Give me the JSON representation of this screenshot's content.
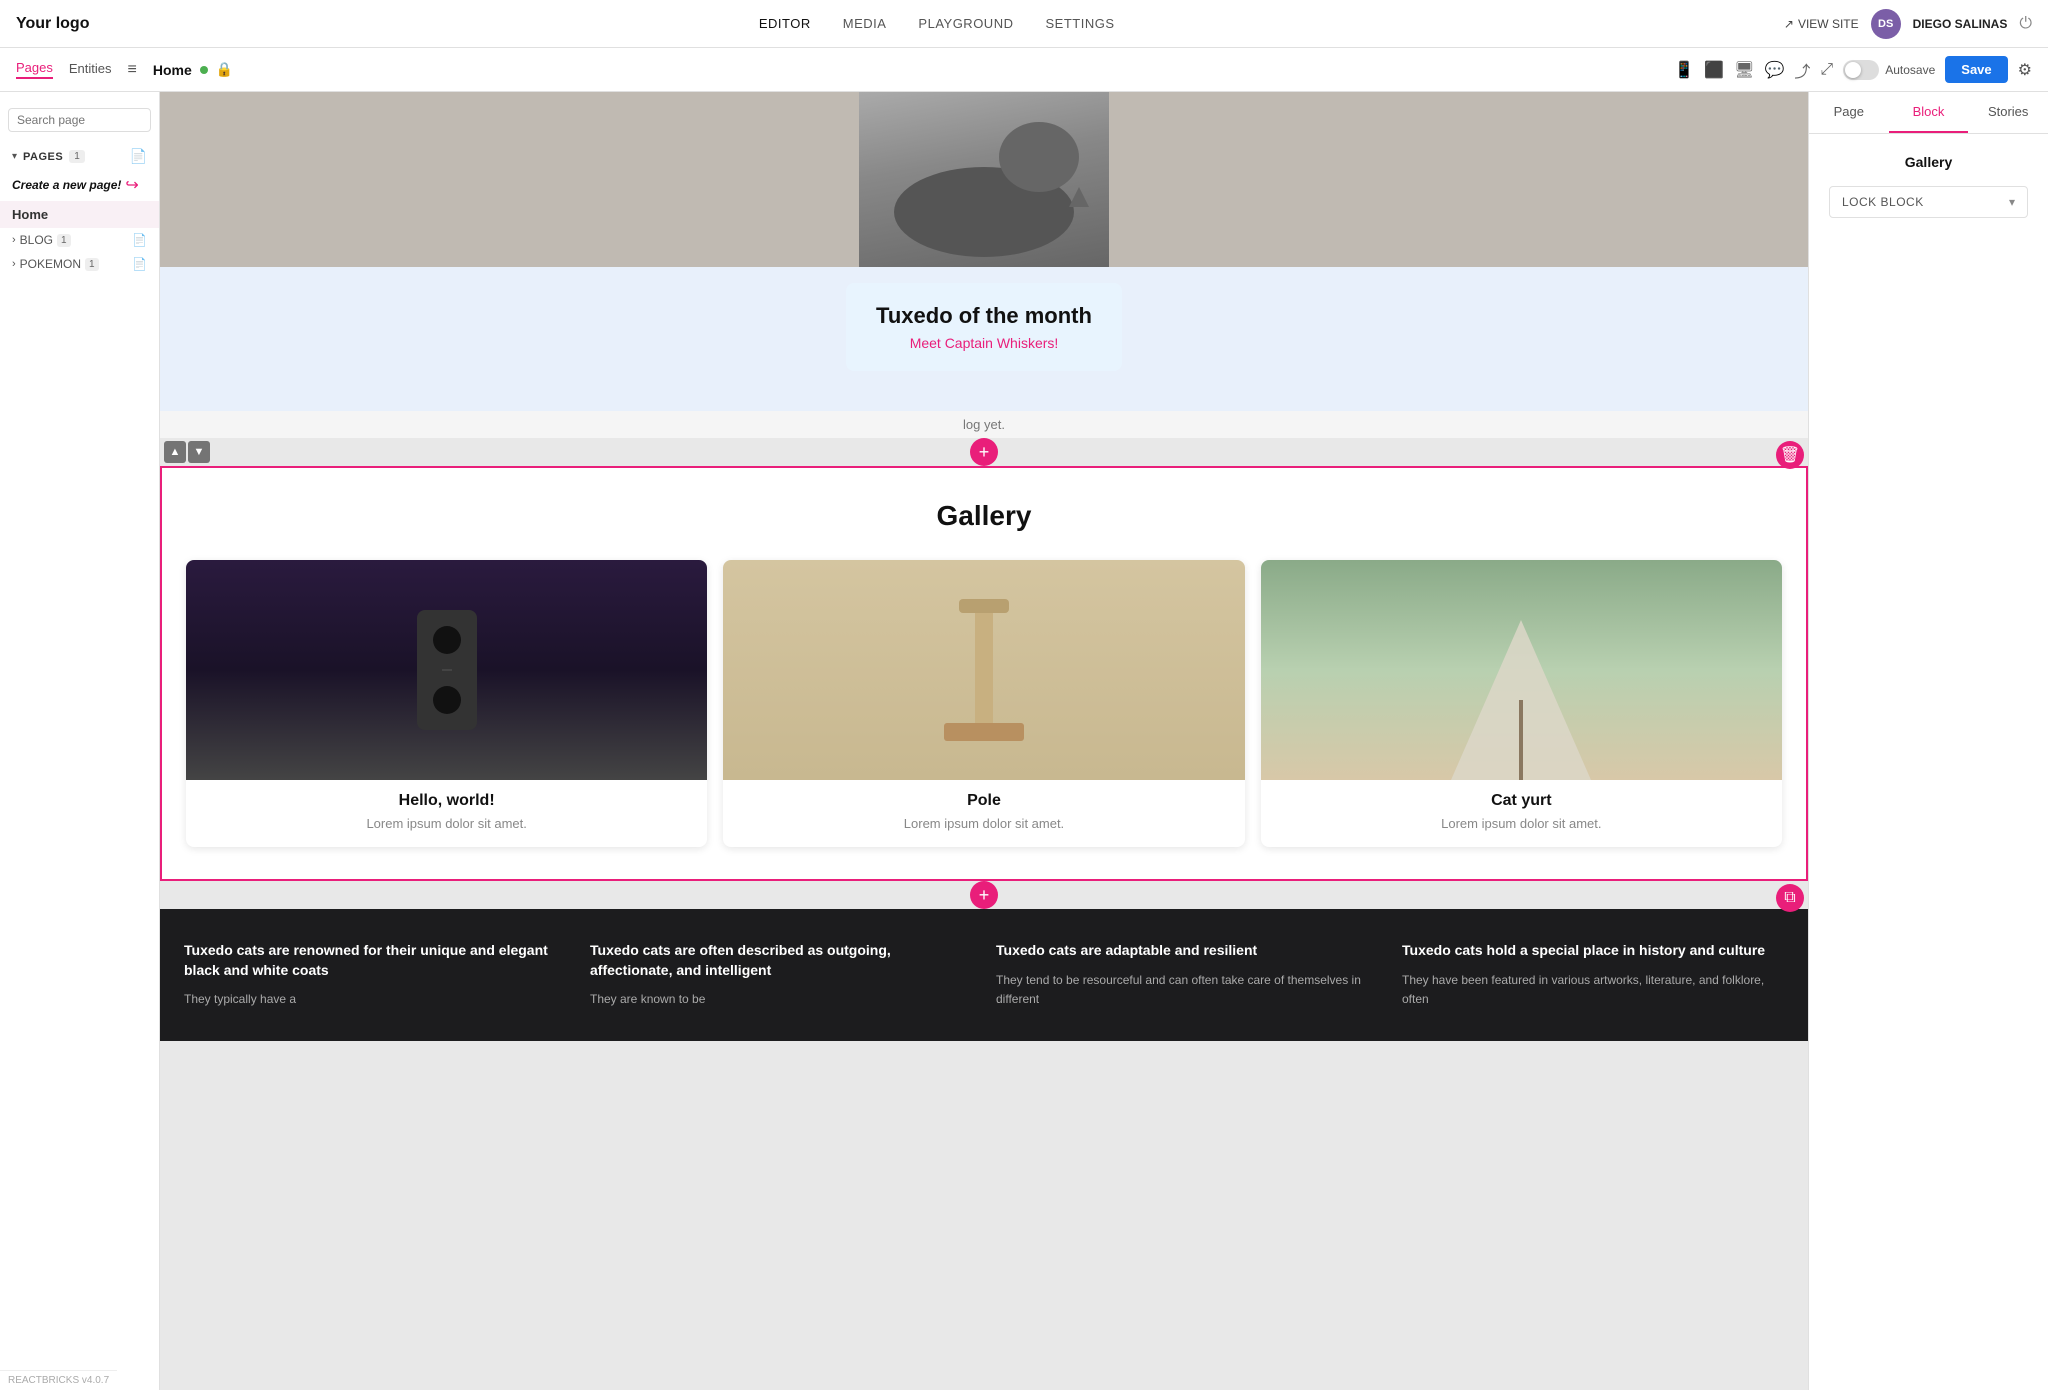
{
  "topnav": {
    "logo": "Your logo",
    "links": [
      "EDITOR",
      "MEDIA",
      "PLAYGROUND",
      "SETTINGS"
    ],
    "active_link": "EDITOR",
    "view_site": "VIEW SITE",
    "user_initials": "DS",
    "user_name": "DIEGO SALINAS"
  },
  "second_toolbar": {
    "tabs": [
      "Pages",
      "Entities"
    ],
    "active_tab": "Pages",
    "page_title": "Home",
    "autosave_label": "Autosave",
    "save_label": "Save"
  },
  "sidebar": {
    "search_placeholder": "Search page",
    "pages_label": "PAGES",
    "pages_count": "1",
    "create_new_label": "Create a new page!",
    "home_label": "Home",
    "blog_label": "BLOG",
    "blog_count": "1",
    "pokemon_label": "POKEMON",
    "pokemon_count": "1"
  },
  "hero_section": {
    "card_title": "Tuxedo of the month",
    "card_subtitle": "Meet Captain Whiskers!",
    "blog_text": "log yet."
  },
  "gallery_section": {
    "title": "Gallery",
    "cards": [
      {
        "title": "Hello, world!",
        "desc": "Lorem ipsum dolor sit amet."
      },
      {
        "title": "Pole",
        "desc": "Lorem ipsum dolor sit amet."
      },
      {
        "title": "Cat yurt",
        "desc": "Lorem ipsum dolor sit amet."
      }
    ]
  },
  "footer_section": {
    "columns": [
      {
        "title": "Tuxedo cats are renowned for their unique and elegant black and white coats",
        "text": "They typically have a"
      },
      {
        "title": "Tuxedo cats are often described as outgoing, affectionate, and intelligent",
        "text": "They are known to be"
      },
      {
        "title": "Tuxedo cats are adaptable and resilient",
        "text": "They tend to be resourceful and can often take care of themselves in different"
      },
      {
        "title": "Tuxedo cats hold a special place in history and culture",
        "text": "They have been featured in various artworks, literature, and folklore, often"
      }
    ]
  },
  "right_panel": {
    "tabs": [
      "Page",
      "Block",
      "Stories"
    ],
    "active_tab": "Block",
    "gallery_label": "Gallery",
    "lock_block_label": "LOCK BLOCK"
  },
  "reactbricks": {
    "label": "REACTBRICKS v4.0.7"
  },
  "icons": {
    "search": "🔍",
    "chevron_down": "▾",
    "chevron_right": "›",
    "plus": "+",
    "trash": "🗑",
    "up": "▲",
    "down": "▼",
    "external_link": "↗",
    "lock": "🔒",
    "mobile": "📱",
    "tablet": "⬛",
    "desktop": "🖥",
    "share": "⤴",
    "settings": "⚙",
    "menu": "≡",
    "page_icon": "📄",
    "copy": "⧉",
    "view_site_arrow": "↗"
  },
  "colors": {
    "accent_pink": "#e91e7a",
    "accent_blue": "#1a73e8",
    "dark_bg": "#1c1c1e"
  }
}
